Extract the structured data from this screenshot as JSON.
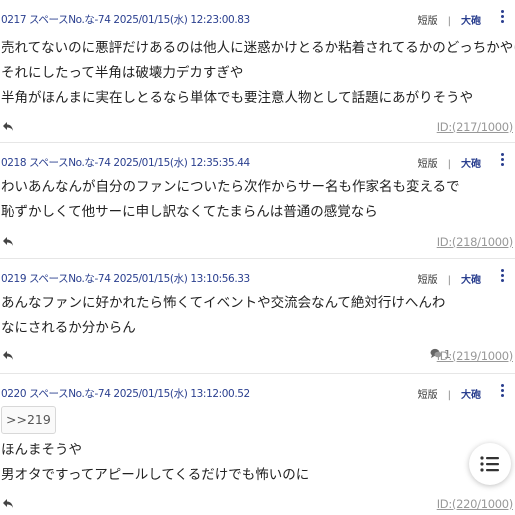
{
  "posts": [
    {
      "meta": "0217 スペースNo.な-74 2025/01/15(水) 12:23:00.83",
      "tag_board": "短版",
      "tag_big": "大砲",
      "lines": [
        "売れてないのに悪評だけあるのは他人に迷惑かけとるか粘着されてるかのどっちかやけど",
        "それにしたって半角は破壊力デカすぎや",
        "半角がほんまに実在しとるなら単体でも要注意人物として話題にあがりそうや"
      ],
      "id_label": "ID:(217/1000)"
    },
    {
      "meta": "0218 スペースNo.な-74 2025/01/15(水) 12:35:35.44",
      "tag_board": "短版",
      "tag_big": "大砲",
      "lines": [
        "わいあんなんが自分のファンについたら次作からサー名も作家名も変えるで",
        "恥ずかしくて他サーに申し訳なくてたまらんは普通の感覚なら"
      ],
      "id_label": "ID:(218/1000)"
    },
    {
      "meta": "0219 スペースNo.な-74 2025/01/15(水) 13:10:56.33",
      "tag_board": "短版",
      "tag_big": "大砲",
      "lines": [
        "あんなファンに好かれたら怖くてイベントや交流会なんて絶対行けへんわ",
        "なにされるか分からん"
      ],
      "comment_count": "1",
      "id_label": "ID:(219/1000)"
    },
    {
      "meta": "0220 スペースNo.な-74 2025/01/15(水) 13:12:00.52",
      "tag_board": "短版",
      "tag_big": "大砲",
      "anchor": ">>219",
      "lines": [
        "ほんまそうや",
        "男オタですってアピールしてくるだけでも怖いのに"
      ],
      "id_label": "ID:(220/1000)"
    }
  ],
  "icons": {
    "reply": "reply-arrow-icon",
    "more": "more-vertical-icon",
    "comment": "comment-bubble-icon",
    "fab": "list-menu-icon"
  },
  "colors": {
    "accent": "#2a3f8f",
    "id_link": "#999999",
    "divider": "#e6e6e6"
  }
}
